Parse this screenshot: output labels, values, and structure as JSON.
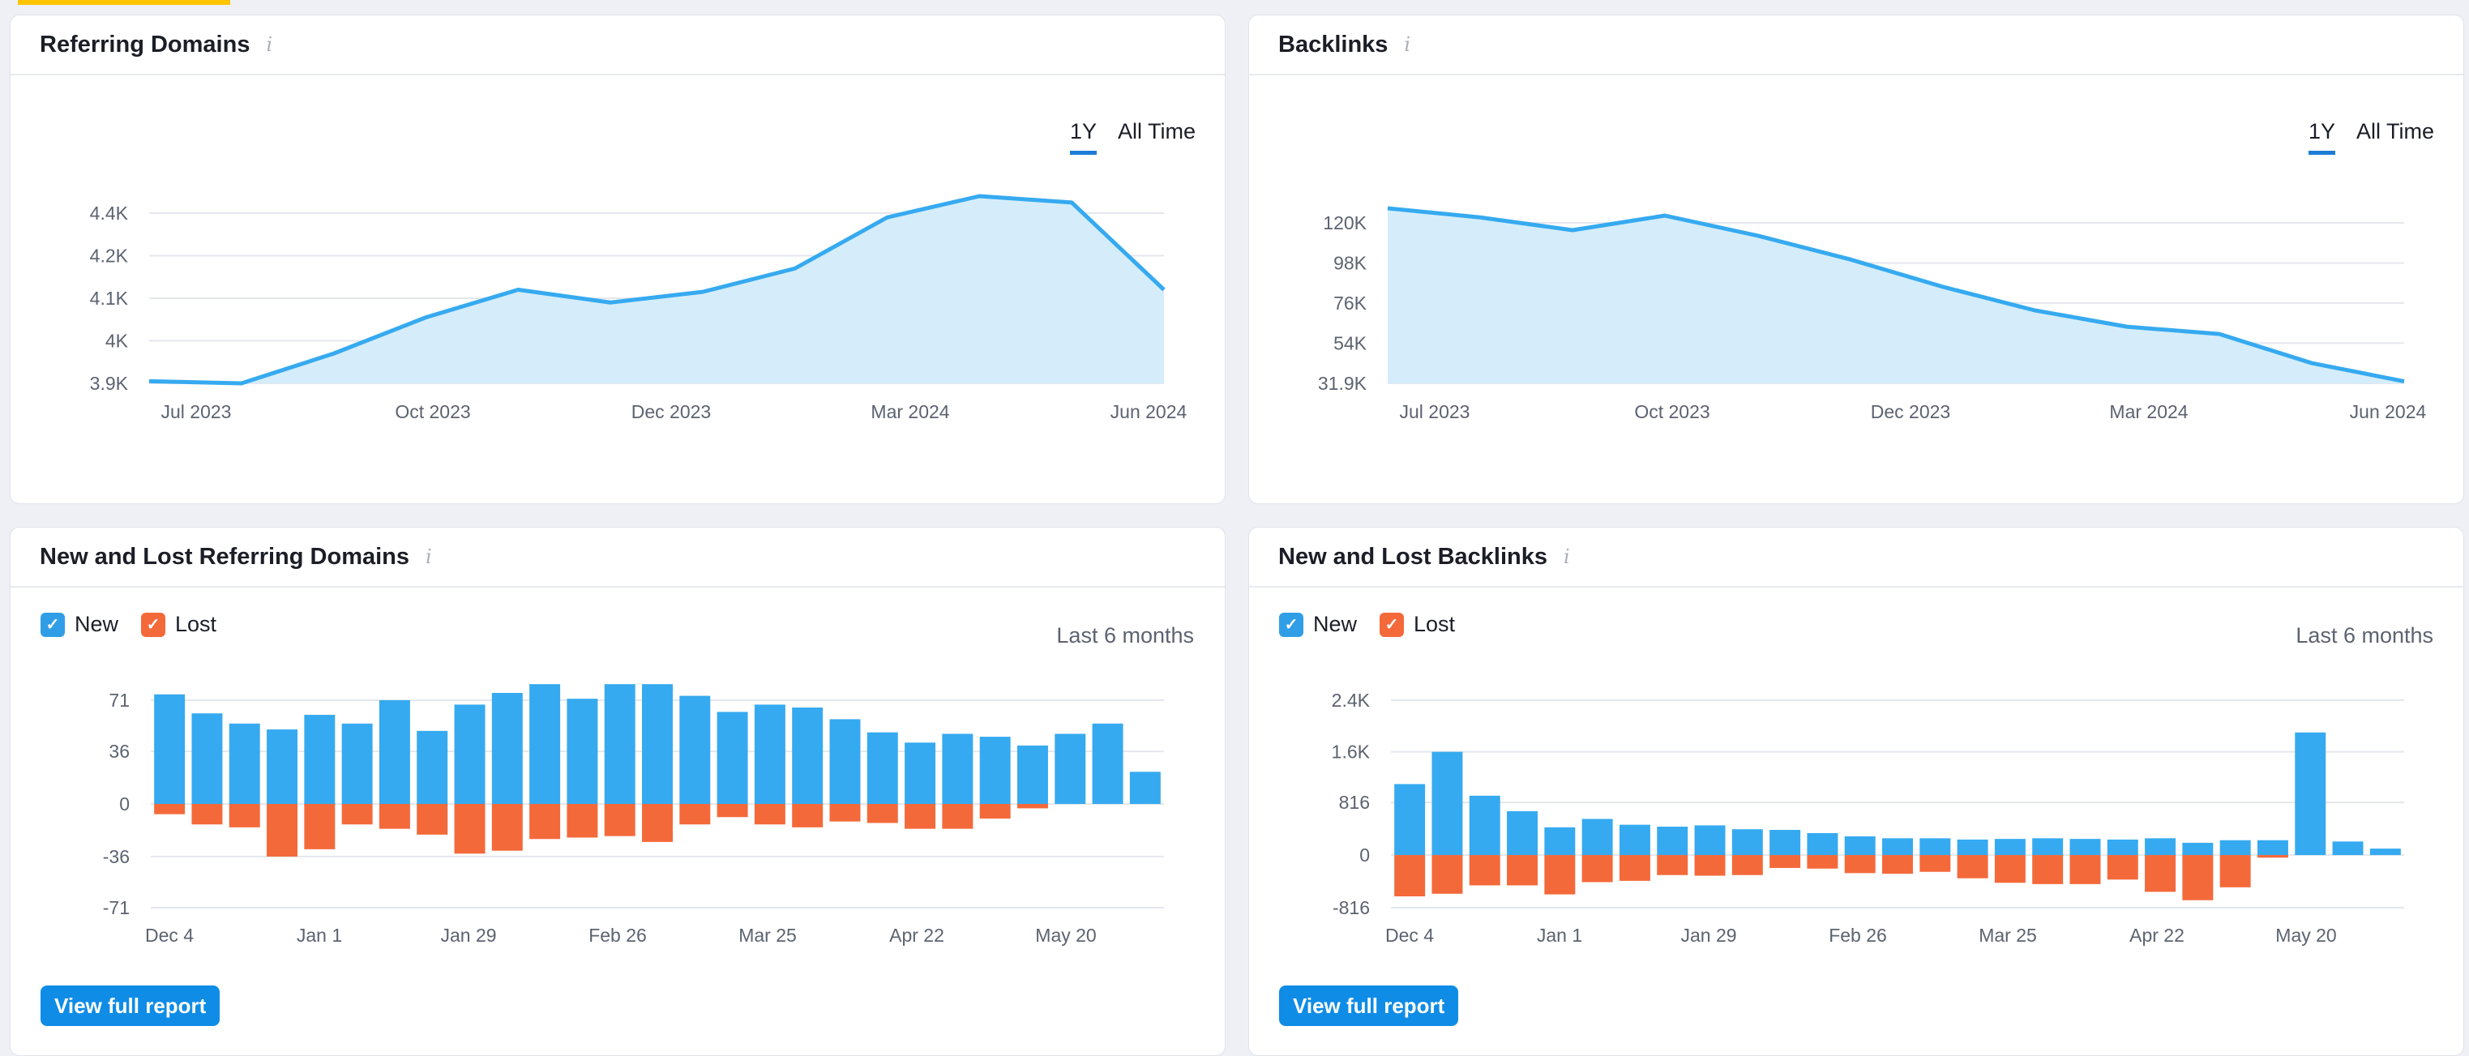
{
  "colors": {
    "accent_line": "#36aaf0",
    "area_fill": "#d5edfa",
    "new_bar": "#36aaf0",
    "lost_bar": "#f4693a",
    "button": "#0f8ce6"
  },
  "panels": {
    "ref_domains": {
      "title": "Referring Domains",
      "range_active": "1Y",
      "range_other": "All Time"
    },
    "backlinks": {
      "title": "Backlinks",
      "range_active": "1Y",
      "range_other": "All Time"
    },
    "new_lost_ref": {
      "title": "New and Lost Referring Domains",
      "legend_new": "New",
      "legend_lost": "Lost",
      "period": "Last 6 months",
      "button": "View full report"
    },
    "new_lost_back": {
      "title": "New and Lost Backlinks",
      "legend_new": "New",
      "legend_lost": "Lost",
      "period": "Last 6 months",
      "button": "View full report"
    }
  },
  "chart_data": [
    {
      "id": "ref_domains",
      "type": "area",
      "title": "Referring Domains",
      "x_ticks": [
        "Jul 2023",
        "Oct 2023",
        "Dec 2023",
        "Mar 2024",
        "Jun 2024"
      ],
      "y_ticks": [
        "3.9K",
        "4K",
        "4.1K",
        "4.2K",
        "4.4K"
      ],
      "y_tick_values": [
        3900,
        4000,
        4100,
        4200,
        4300
      ],
      "ylim": [
        3900,
        4300
      ],
      "values": [
        3905,
        3900,
        3970,
        4055,
        4120,
        4090,
        4115,
        4170,
        4290,
        4340,
        4325,
        4120
      ]
    },
    {
      "id": "backlinks",
      "type": "area",
      "title": "Backlinks",
      "x_ticks": [
        "Jul 2023",
        "Oct 2023",
        "Dec 2023",
        "Mar 2024",
        "Jun 2024"
      ],
      "y_ticks": [
        "31.9K",
        "54K",
        "76K",
        "98K",
        "120K"
      ],
      "y_tick_values": [
        31900,
        54000,
        76000,
        98000,
        120000
      ],
      "ylim": [
        31900,
        120000
      ],
      "values": [
        128000,
        123000,
        116000,
        124000,
        113000,
        100000,
        85000,
        72000,
        63000,
        59000,
        43000,
        33000
      ]
    },
    {
      "id": "new_lost_ref",
      "type": "bar",
      "title": "New and Lost Referring Domains",
      "x_ticks": [
        "Dec 4",
        "Jan 1",
        "Jan 29",
        "Feb 26",
        "Mar 25",
        "Apr 22",
        "May 20"
      ],
      "y_ticks": [
        "71",
        "36",
        "0",
        "-36",
        "-71"
      ],
      "y_tick_values": [
        71,
        36,
        0,
        -36,
        -71
      ],
      "ylim": [
        -71,
        71
      ],
      "new": [
        75,
        62,
        55,
        51,
        61,
        55,
        71,
        50,
        68,
        76,
        82,
        72,
        82,
        82,
        74,
        63,
        68,
        66,
        58,
        49,
        42,
        48,
        46,
        40,
        48,
        55,
        22
      ],
      "lost": [
        -7,
        -14,
        -16,
        -36,
        -31,
        -14,
        -17,
        -21,
        -34,
        -32,
        -24,
        -23,
        -22,
        -26,
        -14,
        -9,
        -14,
        -16,
        -12,
        -13,
        -17,
        -17,
        -10,
        -3,
        0,
        0,
        0
      ]
    },
    {
      "id": "new_lost_back",
      "type": "bar",
      "title": "New and Lost Backlinks",
      "x_ticks": [
        "Dec 4",
        "Jan 1",
        "Jan 29",
        "Feb 26",
        "Mar 25",
        "Apr 22",
        "May 20"
      ],
      "y_ticks": [
        "2.4K",
        "1.6K",
        "816",
        "0",
        "-816"
      ],
      "y_tick_values": [
        2400,
        1600,
        816,
        0,
        -816
      ],
      "ylim": [
        -816,
        2400
      ],
      "new": [
        1100,
        1600,
        920,
        680,
        430,
        560,
        470,
        440,
        460,
        400,
        390,
        340,
        290,
        260,
        260,
        240,
        250,
        260,
        250,
        240,
        260,
        190,
        230,
        230,
        1900,
        210,
        100
      ],
      "lost": [
        -640,
        -600,
        -470,
        -470,
        -610,
        -420,
        -400,
        -310,
        -320,
        -310,
        -200,
        -210,
        -280,
        -290,
        -260,
        -360,
        -430,
        -450,
        -450,
        -380,
        -570,
        -700,
        -500,
        -40,
        0,
        0,
        0
      ]
    }
  ]
}
